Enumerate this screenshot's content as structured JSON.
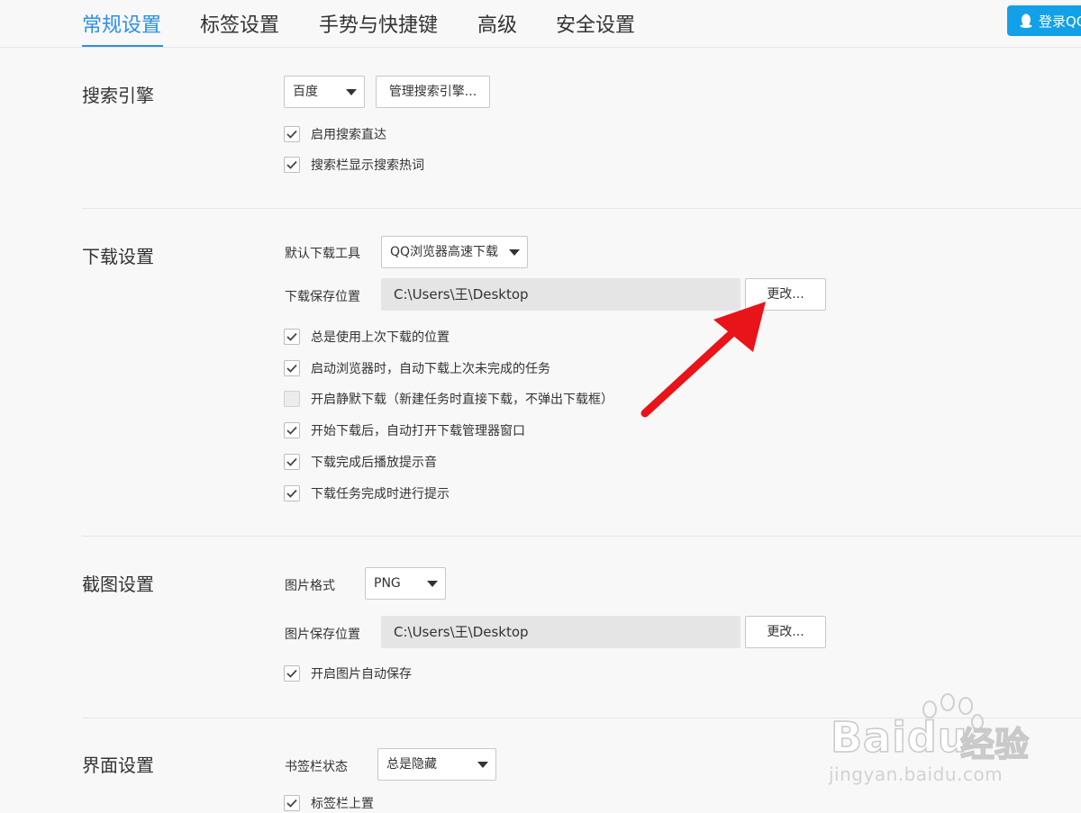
{
  "tabs": [
    {
      "label": "常规设置",
      "active": true
    },
    {
      "label": "标签设置"
    },
    {
      "label": "手势与快捷键"
    },
    {
      "label": "高级"
    },
    {
      "label": "安全设置"
    }
  ],
  "login_button": {
    "label": "登录QQ",
    "icon": "qq-penguin-icon"
  },
  "search_engine": {
    "title": "搜索引擎",
    "engine_select": "百度",
    "manage_button": "管理搜索引擎...",
    "options": [
      {
        "label": "启用搜索直达",
        "checked": true
      },
      {
        "label": "搜索栏显示搜索热词",
        "checked": true
      }
    ]
  },
  "download": {
    "title": "下载设置",
    "tool_label": "默认下载工具",
    "tool_select": "QQ浏览器高速下载",
    "path_label": "下载保存位置",
    "path_value": "C:\\Users\\王\\Desktop",
    "change_button": "更改...",
    "options": [
      {
        "label": "总是使用上次下载的位置",
        "checked": true
      },
      {
        "label": "启动浏览器时，自动下载上次未完成的任务",
        "checked": true
      },
      {
        "label": "开启静默下载（新建任务时直接下载，不弹出下载框）",
        "checked": false
      },
      {
        "label": "开始下载后，自动打开下载管理器窗口",
        "checked": true
      },
      {
        "label": "下载完成后播放提示音",
        "checked": true
      },
      {
        "label": "下载任务完成时进行提示",
        "checked": true
      }
    ]
  },
  "screenshot": {
    "title": "截图设置",
    "format_label": "图片格式",
    "format_select": "PNG",
    "path_label": "图片保存位置",
    "path_value": "C:\\Users\\王\\Desktop",
    "change_button": "更改...",
    "options": [
      {
        "label": "开启图片自动保存",
        "checked": true
      }
    ]
  },
  "interface": {
    "title": "界面设置",
    "bookmark_label": "书签栏状态",
    "bookmark_select": "总是隐藏",
    "options": [
      {
        "label": "标签栏上置",
        "checked": true
      }
    ]
  },
  "annotation": {
    "color": "#e8141a",
    "icon": "red-arrow-icon"
  },
  "watermark": {
    "brand": "Baidu",
    "cn": "经验",
    "url": "jingyan.baidu.com"
  },
  "colors": {
    "accent": "#2c8fe6",
    "login_bg": "#12a0e8"
  }
}
